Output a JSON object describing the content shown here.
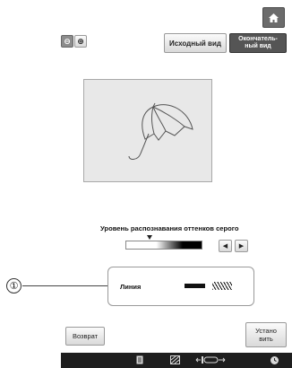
{
  "toolbar": {
    "home_icon": "home-icon",
    "zoom_out_symbol": "⊖",
    "zoom_in_symbol": "⊕",
    "original_view_label": "Исходный вид",
    "final_view_label": "Окончатель-ный вид"
  },
  "grayscale": {
    "label": "Уровень распознавания оттенков серого",
    "left_arrow": "◀",
    "right_arrow": "▶"
  },
  "callout": {
    "number": "①"
  },
  "line_setting": {
    "label": "Линия"
  },
  "footer": {
    "return_label": "Возврат",
    "set_label": "Устано\nвить",
    "icons": [
      "document-icon",
      "fabric-icon",
      "width-icon",
      "clock-icon"
    ]
  },
  "colors": {
    "final_view_bg": "#555555",
    "preview_bg": "#e8e8e8",
    "bottom_bar_bg": "#1e1e1e"
  }
}
